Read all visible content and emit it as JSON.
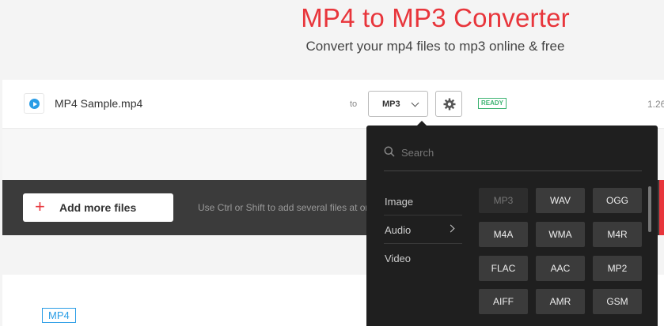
{
  "header": {
    "title": "MP4 to MP3 Converter",
    "subtitle": "Convert your mp4 files to mp3 online & free"
  },
  "file": {
    "name": "MP4 Sample.mp4",
    "to_label": "to",
    "selected_format": "MP3",
    "status": "READY",
    "size": "1.26"
  },
  "actions": {
    "add_files_label": "Add more files",
    "hint": "Use Ctrl or Shift to add several files at once"
  },
  "source_format_badge": "MP4",
  "dropdown": {
    "search_placeholder": "Search",
    "categories": [
      "Image",
      "Audio",
      "Video"
    ],
    "active_category": "Audio",
    "formats": [
      "MP3",
      "WAV",
      "OGG",
      "M4A",
      "WMA",
      "M4R",
      "FLAC",
      "AAC",
      "MP2",
      "AIFF",
      "AMR",
      "GSM"
    ],
    "disabled_format": "MP3"
  },
  "colors": {
    "brand_red": "#e8353b",
    "ready_green": "#3cb371",
    "link_blue": "#2a9de6",
    "dropdown_bg": "#1f1f1f"
  },
  "icons": {
    "file": "play-icon",
    "settings": "gear-icon",
    "add": "plus-icon",
    "search": "search-icon"
  }
}
